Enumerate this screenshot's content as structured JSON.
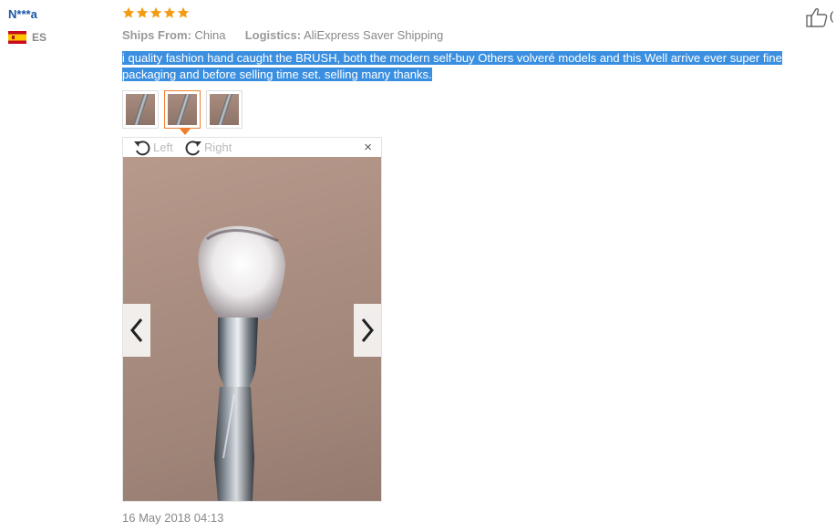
{
  "reviewer": {
    "name": "N***a",
    "country_code": "ES",
    "flag_icon": "spain-flag-icon"
  },
  "rating": {
    "stars": 5,
    "max": 5,
    "color": "#f39c12"
  },
  "helpful": {
    "icon": "thumbs-up-icon",
    "count": "("
  },
  "shipping": {
    "ships_from_label": "Ships From:",
    "ships_from_value": "China",
    "logistics_label": "Logistics:",
    "logistics_value": "AliExpress Saver Shipping"
  },
  "review_text": "i quality fashion hand caught the BRUSH, both the modern self-buy Others volveré models and this Well arrive ever super fine packaging and before selling time set. selling many thanks.",
  "viewer": {
    "rotate_left_label": "Left",
    "rotate_right_label": "Right",
    "close_label": "×",
    "active_thumbnail": 2,
    "thumbnail_count": 3
  },
  "date": "16 May 2018 04:13",
  "colors": {
    "name_link": "#1a56a5",
    "selection": "#3b8fe0",
    "thumb_active_border": "#f07e2e"
  }
}
